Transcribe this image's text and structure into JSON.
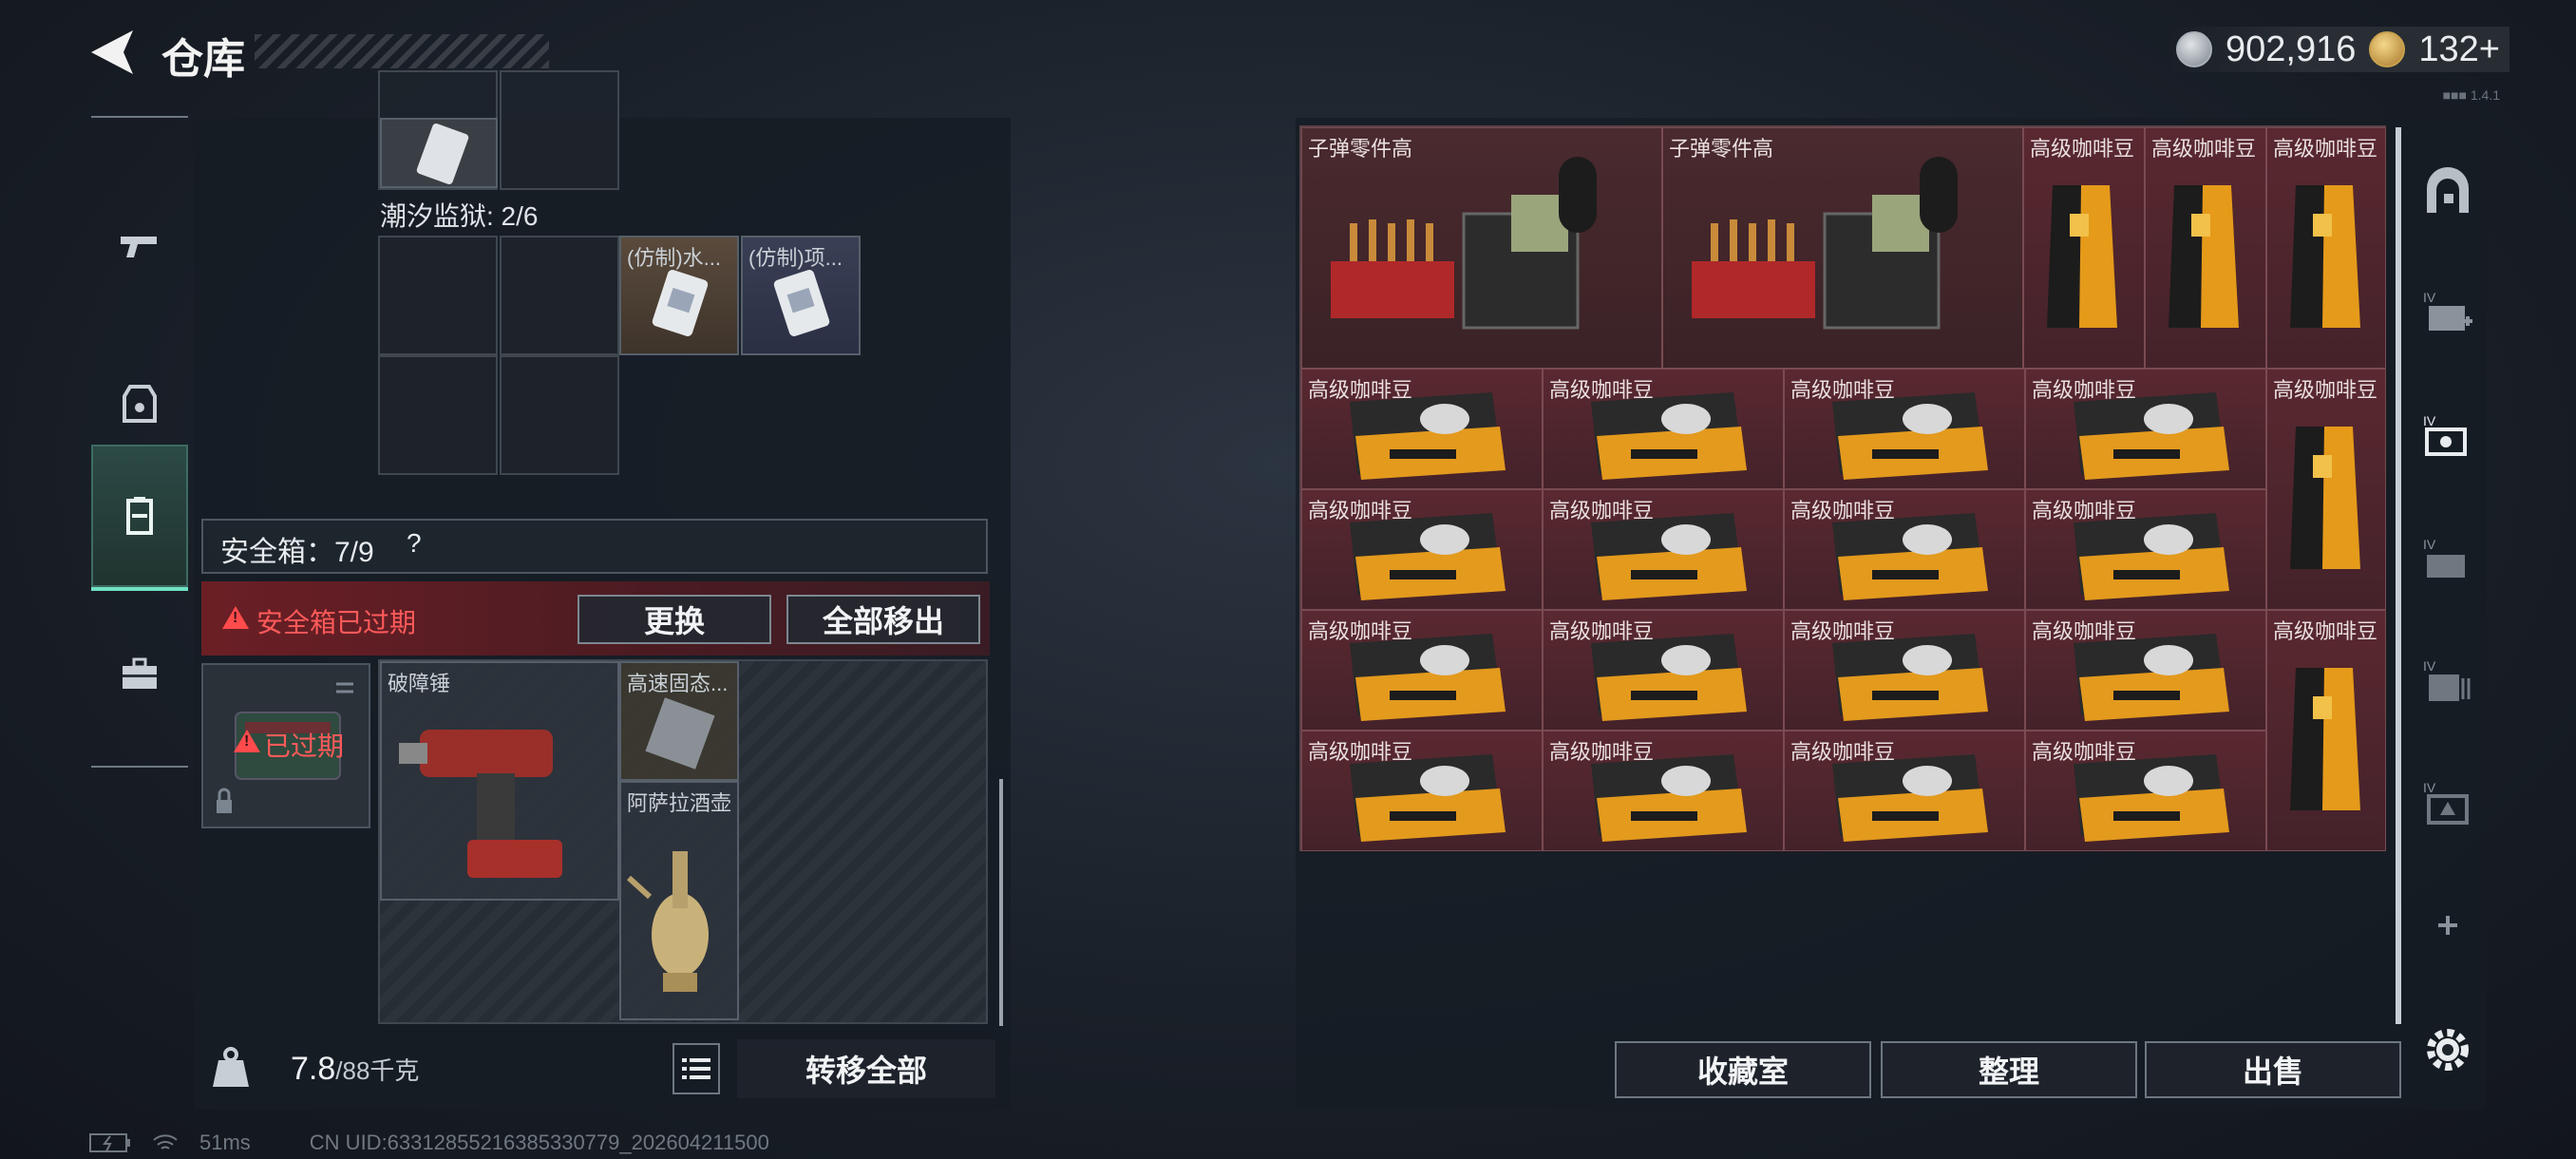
{
  "header": {
    "title": "仓库",
    "silver": "902,916",
    "gold": "132+",
    "version": "■■■ 1.4.1"
  },
  "left_nav": [
    "gun-icon",
    "armor-icon",
    "safe-case-icon",
    "toolbox-icon"
  ],
  "left_panel": {
    "prison_label": "潮汐监狱: 2/6",
    "prison_items": [
      "(仿制)水...",
      "(仿制)项..."
    ],
    "safe_title": "安全箱：7/9",
    "safe_help": "?",
    "expired_warning": "安全箱已过期",
    "replace": "更换",
    "move_all": "全部移出",
    "safebox_status": "已过期",
    "safe_items": [
      "破障锤",
      "高速固态...",
      "阿萨拉酒壶"
    ],
    "weight": "7.8",
    "weight_cap": "/88千克",
    "transfer_all": "转移全部"
  },
  "storage": {
    "ammo_label": "子弹零件高",
    "coffee_label": "高级咖啡豆",
    "stand_labels": [
      "高级咖啡豆",
      "高级咖啡豆",
      "高级咖啡豆",
      "高级咖啡豆",
      "高级咖啡豆"
    ],
    "flat_rows": [
      [
        "高级咖啡豆",
        "高级咖啡豆",
        "高级咖啡豆",
        "高级咖啡豆"
      ],
      [
        "高级咖啡豆",
        "高级咖啡豆",
        "高级咖啡豆",
        "高级咖啡豆"
      ],
      [
        "高级咖啡豆",
        "高级咖啡豆",
        "高级咖啡豆",
        "高级咖啡豆"
      ],
      [
        "高级咖啡豆",
        "高级咖啡豆",
        "高级咖啡豆",
        "高级咖啡豆"
      ]
    ]
  },
  "bottom_buttons": {
    "collection": "收藏室",
    "organize": "整理",
    "sell": "出售"
  },
  "status": {
    "ping": "51ms",
    "uid": "CN UID:6331285521638533077​9_202604211500"
  },
  "colors": {
    "accent": "#6fe0c3",
    "warning": "#ff5a5a",
    "item_bg": "#4e252d"
  }
}
